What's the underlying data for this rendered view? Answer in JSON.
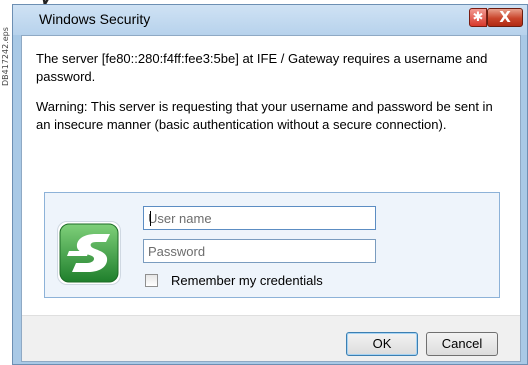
{
  "page": {
    "side_code": "DB417242.eps",
    "partial_heading": "y"
  },
  "window": {
    "title": "Windows Security",
    "close_label": "X",
    "close_star": "✱"
  },
  "message": {
    "line1": "The server [fe80::280:f4ff:fee3:5be] at IFE / Gateway requires a username and password.",
    "warning": "Warning: This server is requesting that your username and password be sent in an insecure manner (basic authentication without a secure connection)."
  },
  "credentials": {
    "username_placeholder": "User name",
    "username_value": "",
    "password_placeholder": "Password",
    "password_value": "",
    "remember_label": "Remember my credentials",
    "remember_checked": false
  },
  "buttons": {
    "ok_label": "OK",
    "cancel_label": "Cancel"
  },
  "colors": {
    "window_frame": "#a9c9e6",
    "panel_bg": "#eef4fb",
    "icon_green": "#2f9a3e",
    "close_red": "#c9452b"
  },
  "icons": {
    "app_icon": "schneider-logo-icon",
    "close": "close-icon"
  }
}
